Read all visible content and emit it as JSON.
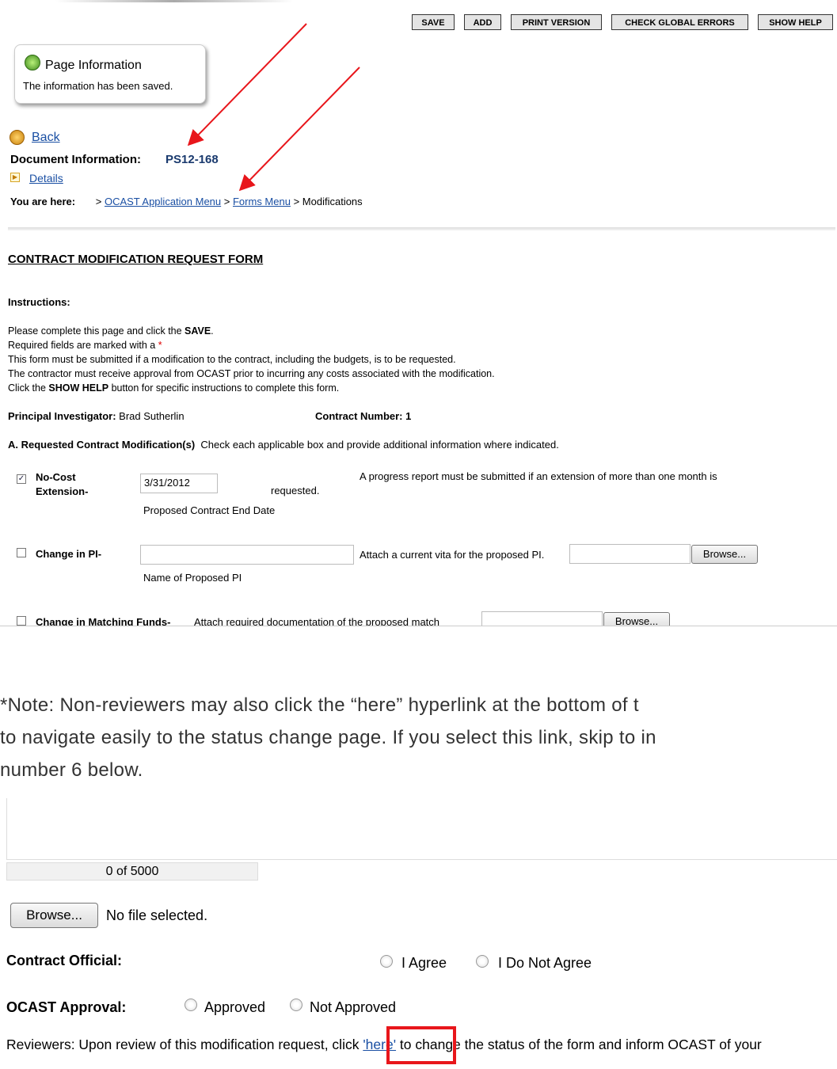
{
  "toolbar": {
    "save": "SAVE",
    "add": "ADD",
    "print": "PRINT VERSION",
    "check_errors": "CHECK GLOBAL ERRORS",
    "show_help": "SHOW HELP"
  },
  "page_info": {
    "title": "Page Information",
    "message": "The information has been saved."
  },
  "nav": {
    "back": "Back",
    "doc_label": "Document Information:",
    "doc_id": "PS12-168",
    "details": "Details",
    "you_are_here": "You are here:",
    "sep": ">",
    "crumb1": "OCAST Application Menu",
    "crumb2": "Forms Menu",
    "crumb3": "Modifications"
  },
  "form": {
    "title": "CONTRACT MODIFICATION REQUEST FORM",
    "instructions_label": "Instructions:",
    "line1_a": "Please complete this page and click the ",
    "line1_b": "SAVE",
    "line1_c": ".",
    "line2_a": "Required fields are marked with a ",
    "line2_star": "*",
    "line3": "This form must be submitted if a modification to the contract, including the budgets, is to be requested.",
    "line4": "The contractor must receive approval from OCAST prior to incurring any costs associated with the modification.",
    "line5_a": "Click the ",
    "line5_b": "SHOW HELP",
    "line5_c": " button for specific instructions to complete this form.",
    "pi_label": "Principal Investigator:",
    "pi_value": "Brad Sutherlin",
    "contract_label": "Contract Number:",
    "contract_value": "1",
    "section_a_label": "A.  Requested Contract Modification(s)",
    "section_a_text": "Check each applicable box and provide additional information where indicated.",
    "nce_label_1": "No-Cost",
    "nce_label_2": "Extension-",
    "nce_date": "3/31/2012",
    "nce_requested": "requested.",
    "nce_note": "A progress report must be submitted if an extension of more than one month is",
    "nce_caption": "Proposed Contract End Date",
    "pi_change_label": "Change in PI-",
    "pi_change_attach": "Attach a current vita for the proposed PI.",
    "browse": "Browse...",
    "pi_change_caption": "Name of Proposed PI",
    "matching_label": "Change in Matching Funds-",
    "matching_attach": "Attach required documentation of the proposed match"
  },
  "note": {
    "line1": "*Note: Non-reviewers may also click the “here” hyperlink at the bottom of t",
    "line2": "to navigate easily to the status change page. If you select this link, skip to in",
    "line3": "number 6 below."
  },
  "bottom": {
    "counter": "0 of 5000",
    "browse": "Browse...",
    "no_file": "No file selected.",
    "official_label": "Contract Official:",
    "agree": "I Agree",
    "disagree": "I Do Not Agree",
    "ocast_label": "OCAST Approval:",
    "approved": "Approved",
    "not_approved": "Not Approved",
    "reviewers_a": "Reviewers: Upon review of this modification request, click ",
    "reviewers_link": "'here'",
    "reviewers_b": " to change the status of the form and inform OCAST of your"
  },
  "colors": {
    "annotation_red": "#e8161b",
    "link_blue": "#1a4fa3"
  }
}
